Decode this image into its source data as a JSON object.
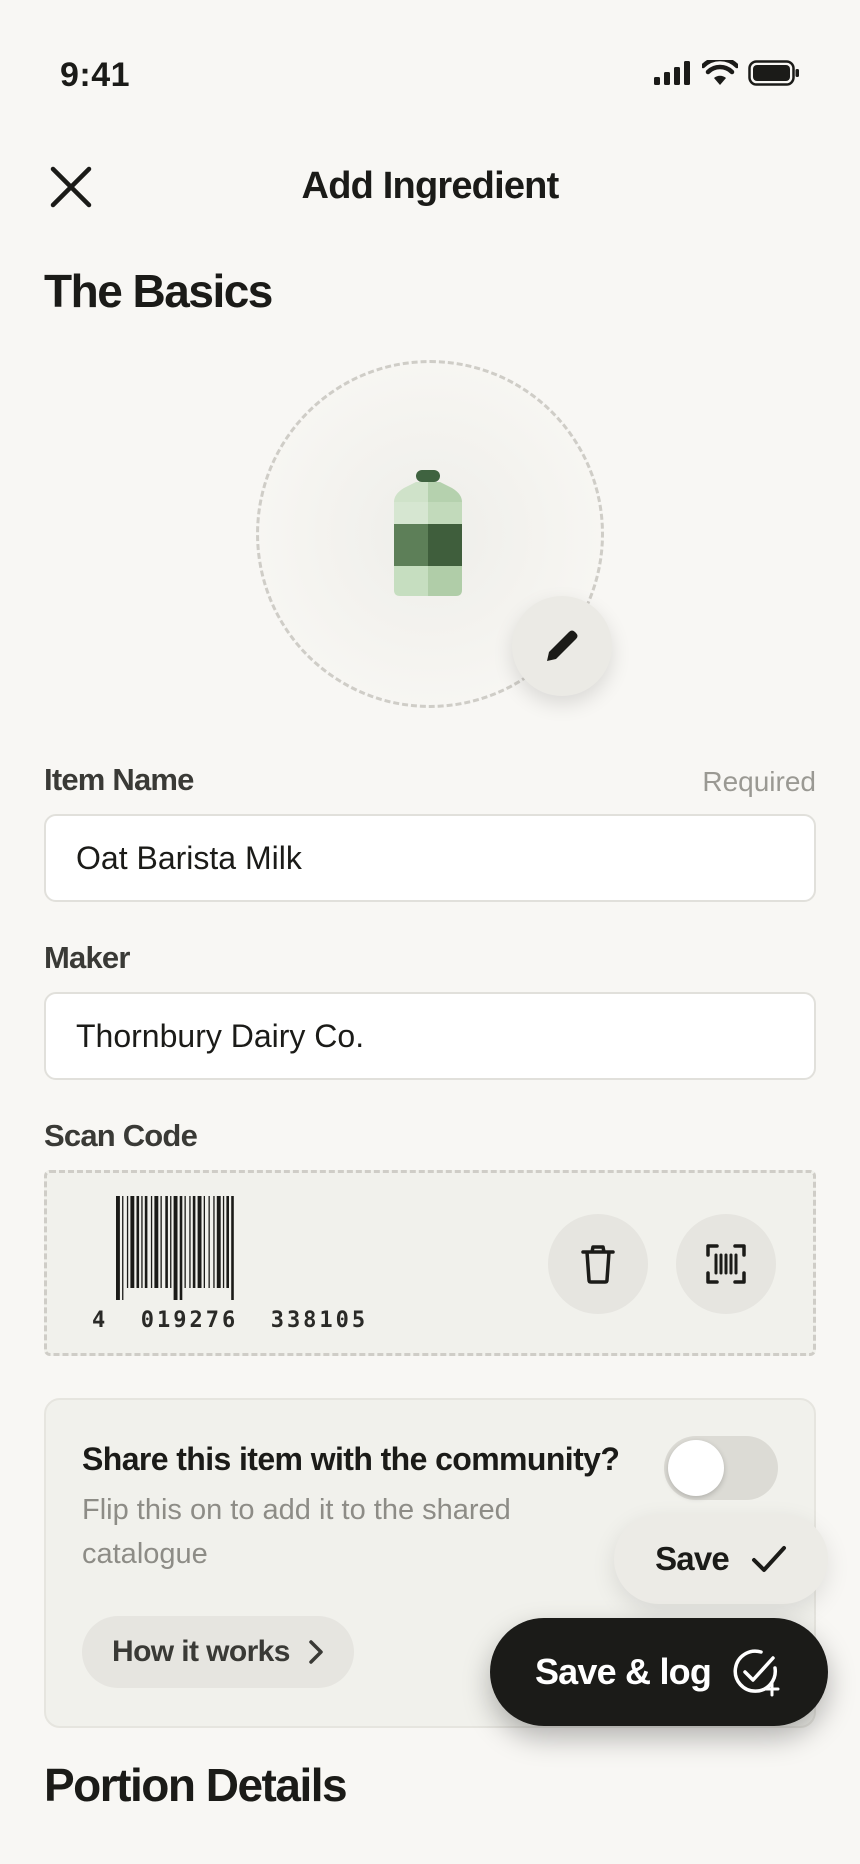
{
  "status_bar": {
    "time": "9:41"
  },
  "header": {
    "title": "Add Ingredient"
  },
  "sections": {
    "basics": "The Basics",
    "portion": "Portion Details"
  },
  "form": {
    "item_name": {
      "label": "Item Name",
      "required_text": "Required",
      "value": "Oat Barista Milk"
    },
    "maker": {
      "label": "Maker",
      "value": "Thornbury Dairy Co."
    },
    "scan_code": {
      "label": "Scan Code",
      "digits": "4  019276  338105"
    }
  },
  "share": {
    "title": "Share this item with the community?",
    "description": "Flip this on to add it to the shared catalogue",
    "toggle_on": false,
    "how_it_works": "How it works"
  },
  "actions": {
    "save": "Save",
    "save_and_log": "Save & log"
  },
  "icons": {
    "close": "close-icon",
    "edit": "pencil-icon",
    "image": "bottle-icon",
    "delete": "trash-icon",
    "scan": "barcode-scan-icon",
    "chevron": "chevron-right-icon",
    "save": "check-icon",
    "save_log": "check-circle-sparkle-icon"
  },
  "colors": {
    "accent_dark": "#1b1b18",
    "bottle_green": "#4a6b48",
    "bottle_light": "#b8d4b2",
    "background": "#f8f7f4"
  }
}
